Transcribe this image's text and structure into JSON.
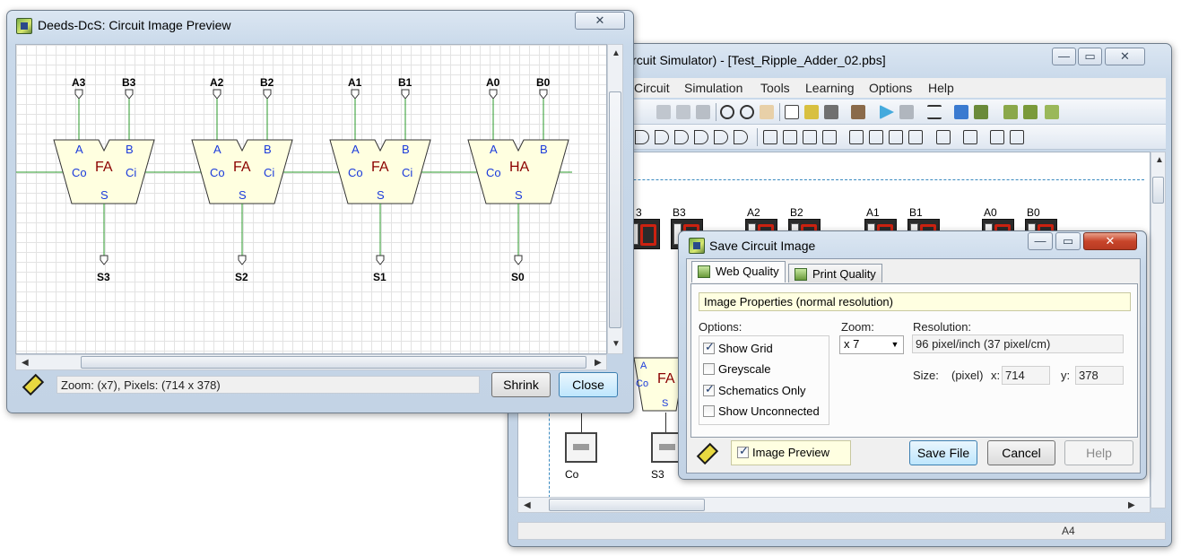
{
  "main_window": {
    "title": "ircuit Simulator) - [Test_Ripple_Adder_02.pbs]",
    "menu": [
      "Circuit",
      "Simulation",
      "Tools",
      "Learning",
      "Options",
      "Help"
    ],
    "status": "A4",
    "labels": {
      "b3": "B3",
      "a2": "A2",
      "b2": "B2",
      "a1": "A1",
      "b1": "B1",
      "a0": "A0",
      "b0": "B0",
      "partial": "3",
      "co": "Co",
      "s3": "S3",
      "fa_a": "A",
      "fa_co": "Co",
      "fa_name": "FA",
      "fa_s": "S"
    }
  },
  "preview_window": {
    "title": "Deeds-DcS: Circuit Image Preview",
    "status": "Zoom: (x7), Pixels: (714 x 378)",
    "shrink_label": "Shrink",
    "close_label": "Close",
    "blocks": [
      {
        "a": "A3",
        "b": "B3",
        "type": "FA",
        "s": "S3",
        "ci": "Ci"
      },
      {
        "a": "A2",
        "b": "B2",
        "type": "FA",
        "s": "S2",
        "ci": "Ci"
      },
      {
        "a": "A1",
        "b": "B1",
        "type": "FA",
        "s": "S1",
        "ci": "Ci"
      },
      {
        "a": "A0",
        "b": "B0",
        "type": "HA",
        "s": "S0",
        "ci": ""
      }
    ],
    "pin_a": "A",
    "pin_b": "B",
    "pin_co": "Co",
    "pin_s": "S"
  },
  "save_dialog": {
    "title": "Save Circuit Image",
    "tabs": [
      "Web Quality",
      "Print Quality"
    ],
    "header": "Image Properties  (normal resolution)",
    "options_label": "Options:",
    "options": [
      {
        "label": "Show Grid",
        "checked": true
      },
      {
        "label": "Greyscale",
        "checked": false
      },
      {
        "label": "Schematics Only",
        "checked": true
      },
      {
        "label": "Show Unconnected",
        "checked": false
      }
    ],
    "zoom_label": "Zoom:",
    "zoom_value": "x 7",
    "resolution_label": "Resolution:",
    "resolution_value": "96 pixel/inch (37 pixel/cm)",
    "size_label": "Size:",
    "pixel_label": "(pixel)",
    "x_label": "x:",
    "x_value": "714",
    "y_label": "y:",
    "y_value": "378",
    "image_preview_label": "Image Preview",
    "image_preview_checked": true,
    "save_label": "Save File",
    "cancel_label": "Cancel",
    "help_label": "Help"
  },
  "colors": {
    "wire": "#2a9a2a",
    "block_fill": "#ffffe0",
    "fa_text": "#8b0000",
    "pin_text": "#1a3adb"
  }
}
